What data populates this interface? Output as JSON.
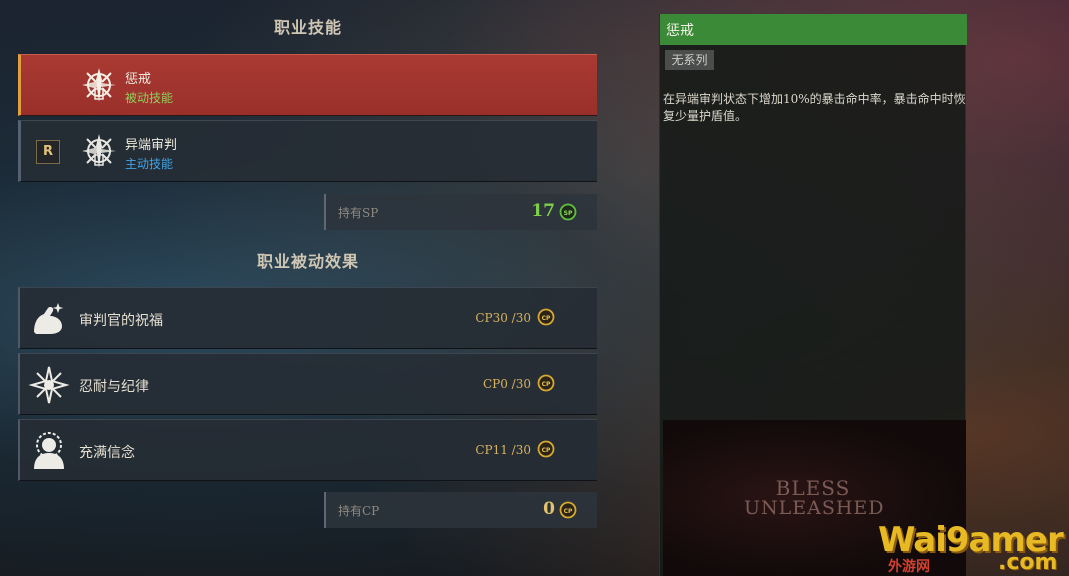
{
  "job_skills": {
    "title": "职业技能",
    "skills": [
      {
        "name": "惩戒",
        "type": "被动技能",
        "icon": "sword-compass-icon"
      },
      {
        "name": "异端审判",
        "type": "主动技能",
        "key": "R",
        "icon": "sword-compass-icon"
      }
    ],
    "sp": {
      "label": "持有SP",
      "value": "17",
      "coin": "SP"
    }
  },
  "job_passives": {
    "title": "职业被动效果",
    "items": [
      {
        "name": "审判官的祝福",
        "cp": "CP30 /30",
        "icon": "flexed-arm-icon"
      },
      {
        "name": "忍耐与纪律",
        "cp": "CP0 /30",
        "icon": "cross-star-icon"
      },
      {
        "name": "充满信念",
        "cp": "CP11 /30",
        "icon": "haloed-figure-icon"
      }
    ],
    "cp": {
      "label": "持有CP",
      "value": "0",
      "coin": "CP"
    }
  },
  "detail": {
    "title": "惩戒",
    "tag": "无系列",
    "description": "在异端审判状态下增加10%的暴击命中率，暴击命中时恢复少量护盾值。"
  },
  "logo": {
    "line1": "BLESS",
    "line2": "UNLEASHED"
  },
  "watermark": {
    "main": "Wai9amer",
    "sub": "外游网",
    "suffix": ".com"
  },
  "colors": {
    "selected_row": "#a93a33",
    "passive_type": "#8fcf5a",
    "active_type": "#3fa6e8",
    "sp_value": "#7fcf4a",
    "cp_value": "#e3c46a",
    "detail_header": "#3a8a37"
  }
}
